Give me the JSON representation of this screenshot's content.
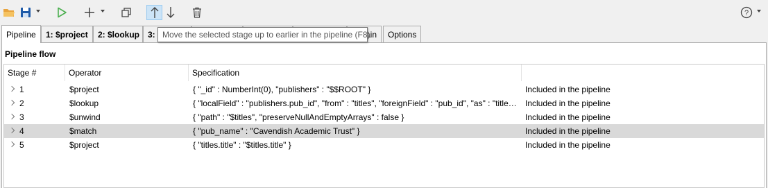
{
  "toolbar": {
    "icons": [
      "folder-open-icon",
      "save-icon",
      "run-icon",
      "add-icon",
      "duplicate-icon",
      "move-up-icon",
      "move-down-icon",
      "delete-icon",
      "help-icon"
    ]
  },
  "tabs": [
    {
      "label": "Pipeline",
      "active": true,
      "bold": false
    },
    {
      "label": "1: $project",
      "active": false,
      "bold": true
    },
    {
      "label": "2: $lookup",
      "active": false,
      "bold": true
    },
    {
      "label": "3:",
      "active": false,
      "bold": true
    },
    {
      "label": "ain",
      "active": false,
      "bold": false
    },
    {
      "label": "Options",
      "active": false,
      "bold": false
    }
  ],
  "tooltip": "Move the selected stage up to earlier in the pipeline (F8)",
  "section_title": "Pipeline flow",
  "table": {
    "columns": [
      "Stage #",
      "Operator",
      "Specification",
      ""
    ],
    "rows": [
      {
        "stage": "1",
        "operator": "$project",
        "spec": "{ \"_id\" : NumberInt(0), \"publishers\" : \"$$ROOT\" }",
        "status": "Included in the pipeline",
        "selected": false
      },
      {
        "stage": "2",
        "operator": "$lookup",
        "spec": "{ \"localField\" : \"publishers.pub_id\", \"from\" : \"titles\", \"foreignField\" : \"pub_id\", \"as\" : \"titles\" }",
        "status": "Included in the pipeline",
        "selected": false
      },
      {
        "stage": "3",
        "operator": "$unwind",
        "spec": "{ \"path\" : \"$titles\", \"preserveNullAndEmptyArrays\" : false }",
        "status": "Included in the pipeline",
        "selected": false
      },
      {
        "stage": "4",
        "operator": "$match",
        "spec": "{ \"pub_name\" : \"Cavendish Academic Trust\" }",
        "status": "Included in the pipeline",
        "selected": true
      },
      {
        "stage": "5",
        "operator": "$project",
        "spec": "{ \"titles.title\" : \"$titles.title\" }",
        "status": "Included in the pipeline",
        "selected": false
      }
    ]
  },
  "colors": {
    "run": "#4caf50",
    "save": "#1e5aa8",
    "folder": "#e8a33c",
    "selected_row": "#d9d9d9",
    "pressed": "#cce4f7"
  }
}
